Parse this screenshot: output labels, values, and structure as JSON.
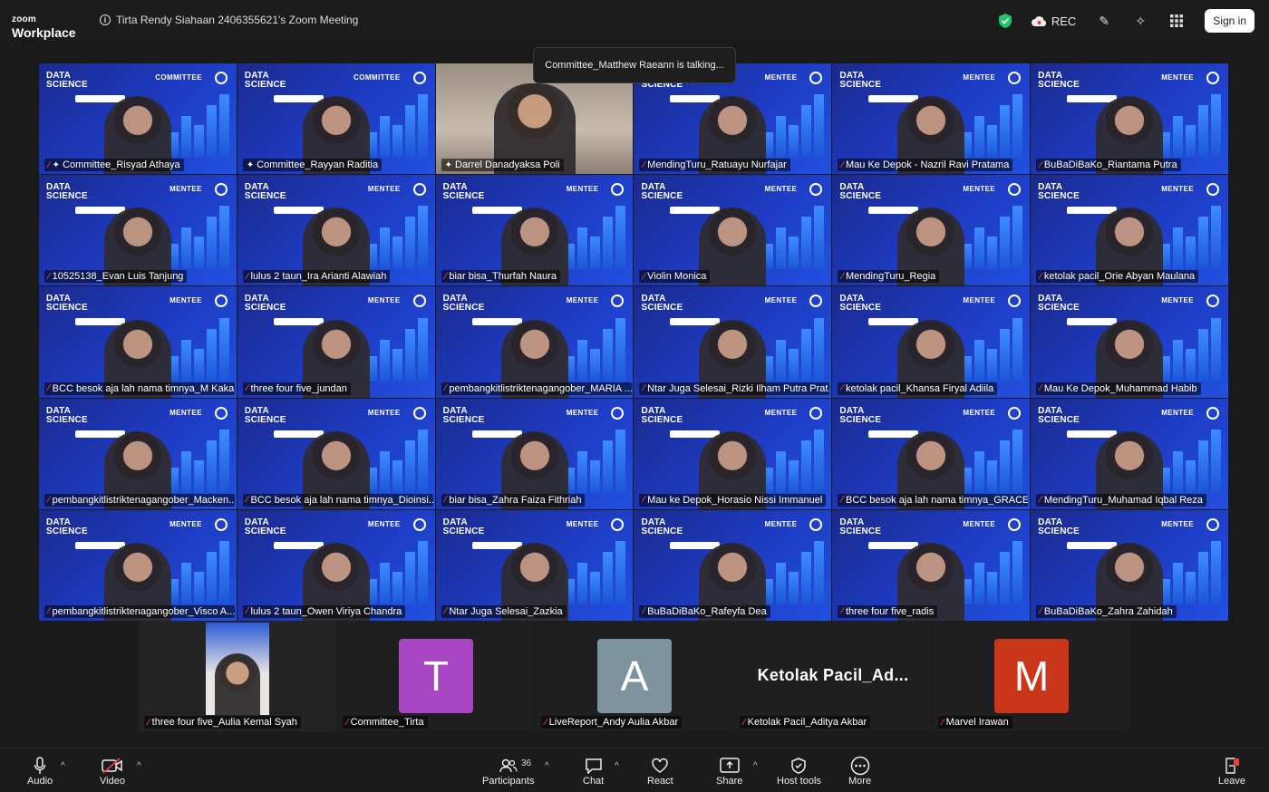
{
  "app": {
    "logo_top": "zoom",
    "logo_bottom": "Workplace",
    "meeting_title": "Tirta Rendy Siahaan 2406355621's Zoom Meeting"
  },
  "topbar": {
    "rec_label": "REC",
    "signin_label": "Sign in"
  },
  "toast": "Committee_Matthew Raeann is talking...",
  "tile_brand": {
    "line1": "DATA",
    "line2": "SCIENCE"
  },
  "tiles": [
    {
      "name": "Committee_Risyad Athaya",
      "badge": "COMMITTEE",
      "pinned": true
    },
    {
      "name": "Committee_Rayyan Raditia",
      "badge": "COMMITTEE",
      "pinned": true,
      "unmuted": true
    },
    {
      "name": "Darrel Danadyaksa Poli",
      "camera": true,
      "pinned": true,
      "unmuted": true
    },
    {
      "name": "MendingTuru_Ratuayu Nurfajar",
      "badge": "MENTEE"
    },
    {
      "name": "Mau Ke Depok - Nazril Ravi Pratama",
      "badge": "MENTEE"
    },
    {
      "name": "BuBaDiBaKo_Riantama Putra",
      "badge": "MENTEE"
    },
    {
      "name": "10525138_Evan Luis Tanjung",
      "badge": "MENTEE"
    },
    {
      "name": "lulus 2 taun_Ira Arianti Alawiah",
      "badge": "MENTEE"
    },
    {
      "name": "biar bisa_Thurfah Naura",
      "badge": "MENTEE"
    },
    {
      "name": "Violin Monica",
      "badge": "MENTEE"
    },
    {
      "name": "MendingTuru_Regia",
      "badge": "MENTEE"
    },
    {
      "name": "ketolak pacil_Orie Abyan Maulana",
      "badge": "MENTEE"
    },
    {
      "name": "BCC besok aja lah nama timnya_M Kaka...",
      "badge": "MENTEE"
    },
    {
      "name": "three four five_jundan",
      "badge": "MENTEE"
    },
    {
      "name": "pembangkitlistriktenagangober_MARIA ...",
      "badge": "MENTEE"
    },
    {
      "name": "Ntar Juga Selesai_Rizki Ilham Putra Prat...",
      "badge": "MENTEE"
    },
    {
      "name": "ketolak pacil_Khansa Firyal Adiila",
      "badge": "MENTEE"
    },
    {
      "name": "Mau Ke Depok_Muhammad Habib",
      "badge": "MENTEE"
    },
    {
      "name": "pembangkitlistriktenagangober_Macken...",
      "badge": "MENTEE"
    },
    {
      "name": "BCC besok aja lah nama timnya_Dioinsi...",
      "badge": "MENTEE"
    },
    {
      "name": "biar bisa_Zahra Faiza Fithriah",
      "badge": "MENTEE"
    },
    {
      "name": "Mau ke Depok_Horasio Nissi Immanuel",
      "badge": "MENTEE"
    },
    {
      "name": "BCC besok aja lah nama timnya_GRACE ...",
      "badge": "MENTEE"
    },
    {
      "name": "MendingTuru_Muhamad Iqbal Reza",
      "badge": "MENTEE"
    },
    {
      "name": "pembangkitlistriktenagangober_Visco A...",
      "badge": "MENTEE"
    },
    {
      "name": "lulus 2 taun_Owen Viriya Chandra",
      "badge": "MENTEE"
    },
    {
      "name": "Ntar Juga Selesai_Zazkia",
      "badge": "MENTEE"
    },
    {
      "name": "BuBaDiBaKo_Rafeyfa Dea",
      "badge": "MENTEE"
    },
    {
      "name": "three four five_radis",
      "badge": "MENTEE"
    },
    {
      "name": "BuBaDiBaKo_Zahra Zahidah",
      "badge": "MENTEE"
    }
  ],
  "strip": [
    {
      "name": "three four five_Aulia Kemal Syah",
      "type": "video"
    },
    {
      "name": "Committee_Tirta",
      "type": "avatar",
      "letter": "T",
      "color": "#a946c4"
    },
    {
      "name": "LiveReport_Andy Aulia Akbar",
      "type": "avatar",
      "letter": "A",
      "color": "#7d939e"
    },
    {
      "name": "Ketolak Pacil_Aditya Akbar",
      "type": "text",
      "display": "Ketolak  Pacil_Ad..."
    },
    {
      "name": "Marvel Irawan",
      "type": "avatar",
      "letter": "M",
      "color": "#c9361a"
    }
  ],
  "toolbar": {
    "audio": "Audio",
    "video": "Video",
    "participants": "Participants",
    "participant_count": "36",
    "chat": "Chat",
    "react": "React",
    "share": "Share",
    "host_tools": "Host tools",
    "more": "More",
    "leave": "Leave"
  },
  "colors": {
    "brand_blue": "#1e3cc4",
    "mute_red": "#e0433b",
    "shield_green": "#21c36b"
  }
}
